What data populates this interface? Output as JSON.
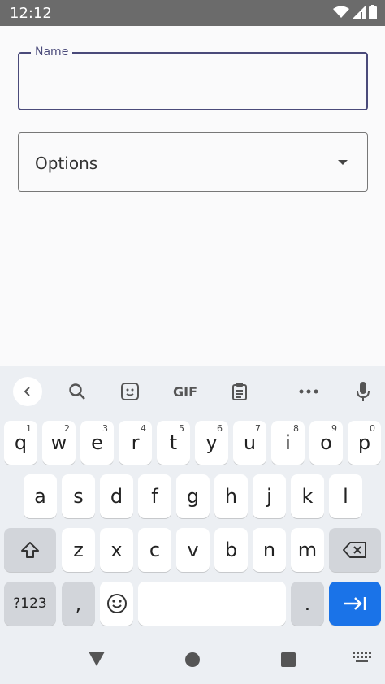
{
  "status_bar": {
    "time": "12:12",
    "icons": [
      "wifi-icon",
      "signal-icon",
      "battery-icon"
    ]
  },
  "form": {
    "name": {
      "label": "Name",
      "value": ""
    },
    "options": {
      "label": "Options"
    }
  },
  "keyboard": {
    "toolbar": {
      "gif_label": "GIF",
      "icons": [
        "back-icon",
        "search-icon",
        "sticker-icon",
        "clipboard-icon",
        "more-icon",
        "mic-icon"
      ]
    },
    "row1": [
      {
        "label": "q",
        "hint": "1"
      },
      {
        "label": "w",
        "hint": "2"
      },
      {
        "label": "e",
        "hint": "3"
      },
      {
        "label": "r",
        "hint": "4"
      },
      {
        "label": "t",
        "hint": "5"
      },
      {
        "label": "y",
        "hint": "6"
      },
      {
        "label": "u",
        "hint": "7"
      },
      {
        "label": "i",
        "hint": "8"
      },
      {
        "label": "o",
        "hint": "9"
      },
      {
        "label": "p",
        "hint": "0"
      }
    ],
    "row2": [
      "a",
      "s",
      "d",
      "f",
      "g",
      "h",
      "j",
      "k",
      "l"
    ],
    "row3": [
      "z",
      "x",
      "c",
      "v",
      "b",
      "n",
      "m"
    ],
    "row4": {
      "symbols": "?123",
      "comma": ",",
      "period": "."
    },
    "accent": "#1a73e8"
  },
  "nav": {
    "icons": [
      "back-triangle-icon",
      "home-circle-icon",
      "recents-square-icon",
      "keyboard-switch-icon"
    ]
  }
}
